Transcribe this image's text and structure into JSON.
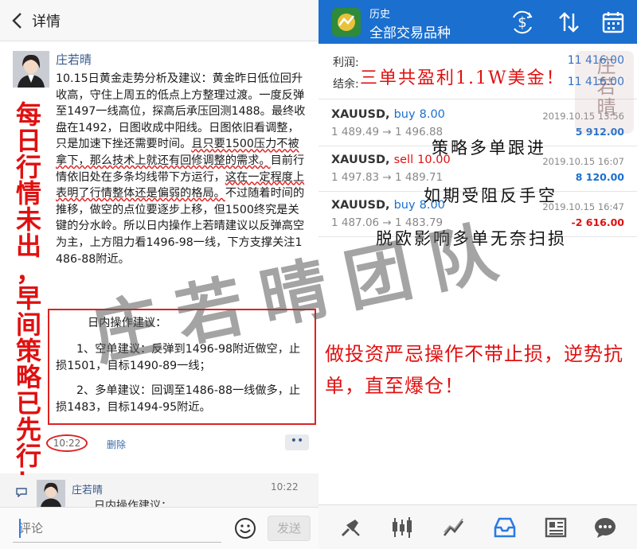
{
  "left": {
    "header": {
      "back_icon": "chevron-left-icon",
      "title": "详情"
    },
    "post": {
      "username": "庄若晴",
      "body_segments": [
        {
          "text": "10.15日黄金走势分析及建议：黄金昨日低位回升收高，守住上周五的低点上方整理过渡。一度反弹至1497一线高位，探高后承压回测1488。最终收盘在1492，日图收成中阳线。日图依旧看调整，只是加速下挫还需要时间。",
          "underline": false
        },
        {
          "text": "且只要1500压力不被拿下，那么技术上就还有回修调整的需求。",
          "underline": true
        },
        {
          "text": "目前行情依旧处在多条均线带下方运行，",
          "underline": false
        },
        {
          "text": "这在一定程度上表明了行情整体还是偏弱的格局。",
          "underline": true
        },
        {
          "text": "不过随着时间的推移，做空的点位要逐步上移，但1500终究是关键的分水岭。所以日内操作上若晴建议以反弹高空为主，上方阻力看1496-98一线，下方支撑关注1486-88附近。",
          "underline": false
        }
      ],
      "advice": {
        "title": "日内操作建议：",
        "item1": "1、空单建议：反弹到1496-98附近做空，止损1501，目标1490-89一线；",
        "item2": "2、多单建议：回调至1486-88一线做多，止损1483，目标1494-95附近。"
      },
      "time": "10:22",
      "delete_label": "删除",
      "more_label": "••"
    },
    "vertical_caption": [
      "每",
      "日",
      "行",
      "情",
      "未",
      "出",
      "，",
      "早",
      "间",
      "策",
      "略",
      "已",
      "先",
      "行",
      "！"
    ],
    "comment": {
      "username": "庄若晴",
      "time": "10:22",
      "text": "日内操作建议："
    },
    "input": {
      "placeholder": "评论",
      "send_label": "发送"
    }
  },
  "right": {
    "header": {
      "title": "历史",
      "subtitle": "全部交易品种"
    },
    "summary": [
      {
        "label": "利润:",
        "value": "11 416.00"
      },
      {
        "label": "结余:",
        "value": "11 416.00"
      }
    ],
    "trades": [
      {
        "symbol": "XAUUSD,",
        "direction": "buy",
        "volume": "8.00",
        "prices": "1 489.49 → 1 496.88",
        "date": "2019.10.15 13:56",
        "profit": "5 912.00",
        "profit_color": "#1a6fcf",
        "dir_color": "#1a6fcf"
      },
      {
        "symbol": "XAUUSD,",
        "direction": "sell",
        "volume": "10.00",
        "prices": "1 497.83 → 1 489.71",
        "date": "2019.10.15 16:07",
        "profit": "8 120.00",
        "profit_color": "#1a6fcf",
        "dir_color": "#e01010"
      },
      {
        "symbol": "XAUUSD,",
        "direction": "buy",
        "volume": "8.00",
        "prices": "1 487.06 → 1 483.79",
        "date": "2019.10.15 16:47",
        "profit": "-2 616.00",
        "profit_color": "#e01010",
        "dir_color": "#1a6fcf"
      }
    ],
    "annotations": {
      "trade1": "策略多单跟进",
      "trade2": "如期受阻反手空",
      "trade3": "脱欧影响多单无奈扫损"
    },
    "headline": "三单共盈利1.1W美金！",
    "warning": "做投资严忌操作不带止损，逆势抗单，直至爆仓！",
    "nav_icons": [
      "trade-icon",
      "chart-icon",
      "trend-icon",
      "history-icon",
      "news-icon",
      "chat-icon"
    ]
  },
  "watermark": "庄若晴团队",
  "seal": "庄若晴"
}
